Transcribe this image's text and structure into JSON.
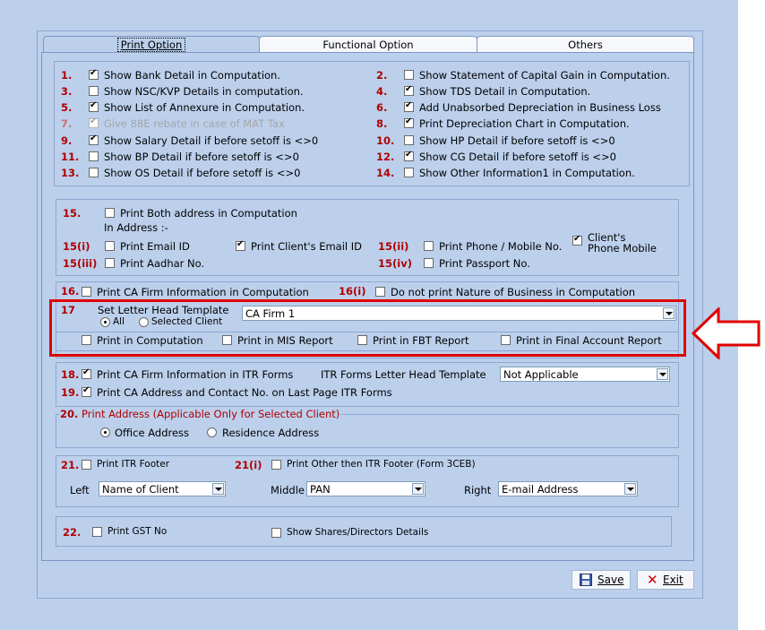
{
  "tabs": [
    "Print Option",
    "Functional Option",
    "Others"
  ],
  "section1": {
    "items": [
      {
        "num": "1.",
        "label": "Show Bank Detail in Computation.",
        "checked": true
      },
      {
        "num": "3.",
        "label": "Show NSC/KVP Details in computation.",
        "checked": false
      },
      {
        "num": "5.",
        "label": "Show List of Annexure in Computation.",
        "checked": true
      },
      {
        "num": "7.",
        "label": "Give 88E rebate in case of MAT Tax",
        "checked": true,
        "disabled": true
      },
      {
        "num": "9.",
        "label": "Show Salary Detail if before setoff is <>0",
        "checked": true
      },
      {
        "num": "11.",
        "label": "Show BP Detail if before setoff is <>0",
        "checked": false
      },
      {
        "num": "13.",
        "label": "Show OS Detail if before setoff is <>0",
        "checked": false
      },
      {
        "num": "2.",
        "label": "Show Statement of Capital Gain in Computation.",
        "checked": false
      },
      {
        "num": "4.",
        "label": "Show TDS Detail in Computation.",
        "checked": true
      },
      {
        "num": "6.",
        "label": "Add Unabsorbed Depreciation in Business Loss",
        "checked": true
      },
      {
        "num": "8.",
        "label": "Print Depreciation Chart in Computation.",
        "checked": true
      },
      {
        "num": "10.",
        "label": "Show HP Detail if before setoff is <>0",
        "checked": false
      },
      {
        "num": "12.",
        "label": "Show CG Detail if before setoff is <>0",
        "checked": true
      },
      {
        "num": "14.",
        "label": "Show Other Information1 in Computation.",
        "checked": false
      }
    ]
  },
  "section15": {
    "num15": "15.",
    "both_address": "Print Both address in Computation",
    "in_address": "In Address :-",
    "num15i": "15(i)",
    "email": "Print Email ID",
    "client_email": "Print Client's Email ID",
    "num15ii": "15(ii)",
    "phone": "Print Phone / Mobile No.",
    "client_phone_1": "Client's",
    "client_phone_2": "Phone Mobile",
    "num15iii": "15(iii)",
    "aadhar": "Print Aadhar No.",
    "num15iv": "15(iv)",
    "passport": "Print Passport No."
  },
  "section16": {
    "num16": "16.",
    "ca_firm": "Print CA Firm Information in Computation",
    "num16i": "16(i)",
    "nature": "Do not print Nature of Business in Computation"
  },
  "section17": {
    "num": "17",
    "label": "Set Letter Head Template",
    "radio_all": "All",
    "radio_selected": "Selected Client",
    "template_value": "CA Firm 1",
    "print_computation": "Print in Computation",
    "print_mis": "Print in MIS Report",
    "print_fbt": "Print in FBT Report",
    "print_final": "Print in Final Account Report"
  },
  "section18": {
    "num18": "18.",
    "itr_info": "Print CA Firm Information in ITR Forms",
    "itr_template_label": "ITR Forms Letter Head Template",
    "itr_template_value": "Not Applicable",
    "num19": "19.",
    "last_page": "Print CA Address and Contact No. on Last Page ITR Forms"
  },
  "section20": {
    "legend_num": "20.",
    "legend": "Print Address (Applicable Only for Selected Client)",
    "office": "Office Address",
    "residence": "Residence Address"
  },
  "section21": {
    "num21": "21.",
    "itr_footer": "Print ITR Footer",
    "num21i": "21(i)",
    "other_footer": "Print Other then ITR Footer (Form 3CEB)",
    "left_label": "Left",
    "left_value": "Name of Client",
    "middle_label": "Middle",
    "middle_value": "PAN",
    "right_label": "Right",
    "right_value": "E-mail Address"
  },
  "section22": {
    "num22": "22.",
    "gst": "Print GST No",
    "shares": "Show Shares/Directors Details"
  },
  "buttons": {
    "save": "Save",
    "exit": "Exit"
  },
  "colors": {
    "background": "#bcd0ec",
    "number_red": "#b00000",
    "highlight_red": "#e00000"
  }
}
